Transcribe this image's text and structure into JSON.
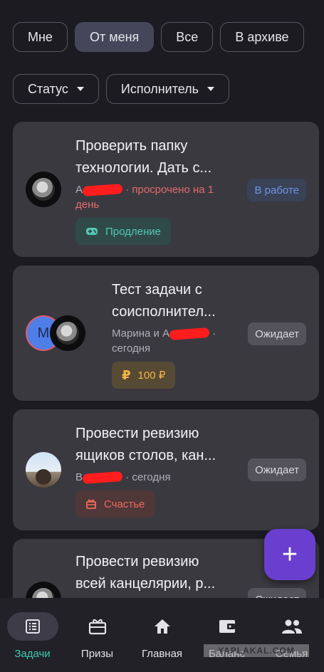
{
  "filters": {
    "row1": [
      "Мне",
      "От меня",
      "Все",
      "В архиве"
    ],
    "active": "От меня",
    "row2": [
      "Статус",
      "Исполнитель"
    ]
  },
  "tasks": [
    {
      "title_line1": "Проверить папку",
      "title_line2": "технологии. Дать с...",
      "assignee_prefix": "А",
      "due": "· просрочено на 1",
      "due_line2": "день",
      "status": "В работе",
      "tag": "Продление",
      "tag_icon": "gamepad-icon"
    },
    {
      "title_line1": "Тест задачи с",
      "title_line2": "соисполнител...",
      "assignee_prefix": "Марина и А",
      "due": "·",
      "due_line2": "сегодня",
      "avatar_letter": "М",
      "status": "Ожидает",
      "tag": "100 ₽",
      "tag_icon": "₽"
    },
    {
      "title_line1": "Провести ревизию",
      "title_line2": "ящиков столов, кан...",
      "assignee_prefix": "В",
      "due": "· сегодня",
      "status": "Ожидает",
      "tag": "Счастье",
      "tag_icon": "gift-icon"
    },
    {
      "title_line1": "Провести ревизию",
      "title_line2": "всей канцелярии, р...",
      "status": "Ожидает"
    }
  ],
  "fab": {
    "label": "+"
  },
  "nav": [
    {
      "label": "Задачи",
      "icon": "tasks-list-icon",
      "active": true
    },
    {
      "label": "Призы",
      "icon": "gift-icon"
    },
    {
      "label": "Главная",
      "icon": "home-icon"
    },
    {
      "label": "Баланс",
      "icon": "wallet-icon"
    },
    {
      "label": "Семья",
      "icon": "family-icon"
    }
  ],
  "watermark": "YAPLAKAL.COM",
  "colors": {
    "accent": "#3fc9b0",
    "fab": "#6a3fd0",
    "late": "#e36c6c"
  }
}
